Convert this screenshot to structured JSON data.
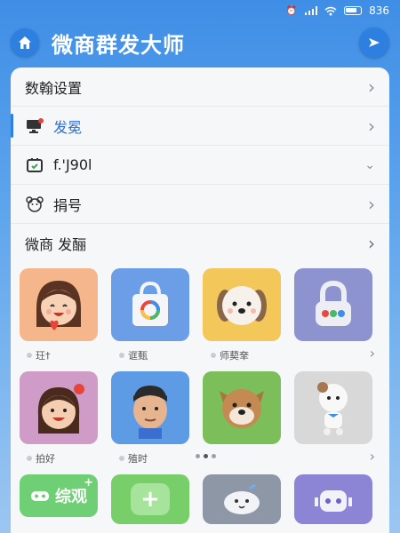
{
  "status_bar": {
    "battery": "836"
  },
  "header": {
    "title": "微商群发大师"
  },
  "menu": [
    {
      "label": "数翰设置"
    },
    {
      "label": "发冕"
    },
    {
      "label": "f.'J90l"
    },
    {
      "label": "捐号"
    }
  ],
  "section": {
    "title": "微商 发酾"
  },
  "row1_captions": [
    "玨†",
    "诓甄",
    "师葜羍"
  ],
  "row2_captions": [
    "拍好",
    "殖时"
  ],
  "bottom": {
    "green_label": "综观"
  },
  "colors": {
    "accent": "#2d7fe0",
    "brand_green": "#6fcf74"
  }
}
